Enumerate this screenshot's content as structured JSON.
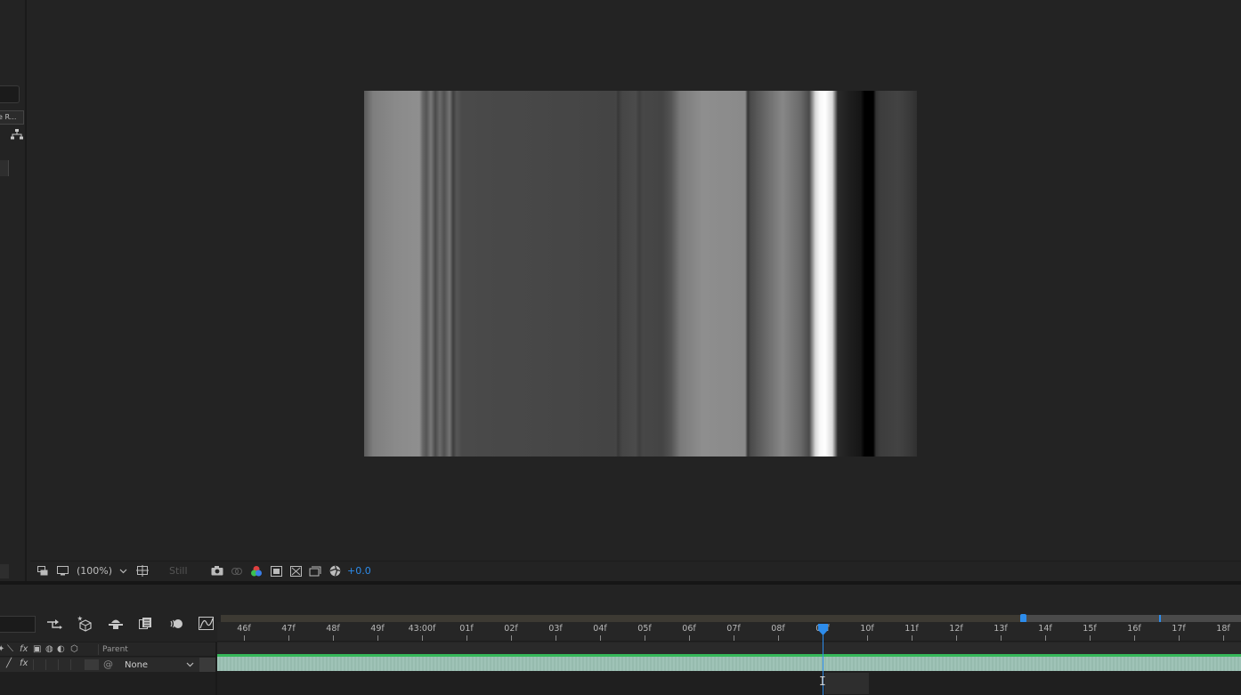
{
  "project_panel": {
    "tab_fragment": "e R..."
  },
  "viewer": {
    "magnification": "(100%)",
    "resolution": "Still",
    "exposure": "+0.0"
  },
  "timeline": {
    "columns": {
      "parent": "Parent"
    },
    "layer": {
      "parent_value": "None"
    },
    "ruler": [
      "46f",
      "47f",
      "48f",
      "49f",
      "43:00f",
      "01f",
      "02f",
      "03f",
      "04f",
      "05f",
      "06f",
      "07f",
      "08f",
      "09f",
      "10f",
      "11f",
      "12f",
      "13f",
      "14f",
      "15f",
      "16f",
      "17f",
      "18f"
    ],
    "current_frame_index": 13
  },
  "colors": {
    "accent": "#2d8ceb",
    "layer_bar_top": "#36b85a",
    "layer_bar": "#9bc1b4",
    "panel_bg": "#232323"
  }
}
